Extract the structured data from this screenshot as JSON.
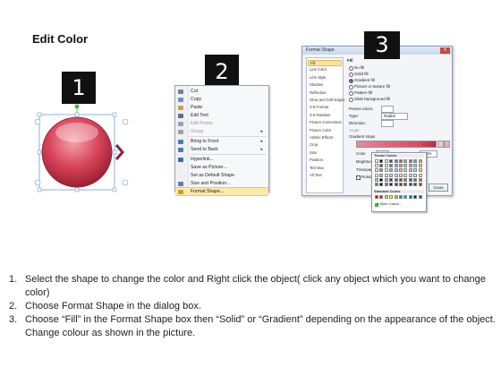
{
  "title": "Edit Color",
  "badges": [
    "1",
    "2",
    "3"
  ],
  "context_menu": {
    "items": [
      {
        "label": "Cut",
        "icon": "scissors-icon",
        "color": "#6f7fa0",
        "submenu": false
      },
      {
        "label": "Copy",
        "icon": "copy-icon",
        "color": "#7b8db3",
        "submenu": false
      },
      {
        "label": "Paste",
        "icon": "paste-icon",
        "color": "#c9a24a",
        "submenu": false
      },
      {
        "label": "Edit Text",
        "icon": "edit-text-icon",
        "color": "#5d6f8d",
        "submenu": false
      },
      {
        "label": "Edit Points",
        "icon": "edit-points-icon",
        "color": "#9aa2ad",
        "submenu": false
      },
      {
        "label": "Group",
        "icon": "group-icon",
        "color": "#9aa2ad",
        "submenu": true
      },
      {
        "label": "Bring to Front",
        "icon": "bring-front-icon",
        "color": "#4f78b8",
        "submenu": true
      },
      {
        "label": "Send to Back",
        "icon": "send-back-icon",
        "color": "#4f78b8",
        "submenu": true
      },
      {
        "label": "Hyperlink...",
        "icon": "hyperlink-icon",
        "color": "#3a6fb0",
        "submenu": false
      },
      {
        "label": "Save as Picture...",
        "icon": "",
        "color": "",
        "submenu": false
      },
      {
        "label": "Set as Default Shape",
        "icon": "",
        "color": "",
        "submenu": false
      },
      {
        "label": "Size and Position...",
        "icon": "size-position-icon",
        "color": "#5a7fb0",
        "submenu": false
      },
      {
        "label": "Format Shape...",
        "icon": "format-shape-icon",
        "color": "#d29a2e",
        "submenu": false
      }
    ]
  },
  "dialog": {
    "title": "Format Shape",
    "close_label": "X",
    "categories": [
      "Fill",
      "Line Color",
      "Line Style",
      "Shadow",
      "Reflection",
      "Glow and Soft Edges",
      "3-D Format",
      "3-D Rotation",
      "Picture Corrections",
      "Picture Color",
      "Artistic Effects",
      "Crop",
      "Size",
      "Position",
      "Text Box",
      "Alt Text"
    ],
    "selected_category": "Fill",
    "fill_heading": "Fill",
    "fill_options": [
      "No fill",
      "Solid fill",
      "Gradient fill",
      "Picture or texture fill",
      "Pattern fill",
      "Slide background fill"
    ],
    "selected_fill": "Gradient fill",
    "preset_colors_label": "Preset colors:",
    "type_label": "Type:",
    "type_value": "Radial",
    "direction_label": "Direction:",
    "angle_label": "Angle:",
    "gradient_stops_label": "Gradient stops",
    "color_label": "Color",
    "position_label": "Position:",
    "position_value": "100%",
    "brightness_label": "Brightness:",
    "transparency_label": "Transparency:",
    "rotate_label": "Rotate with shape",
    "close_button": "Close",
    "theme_colors_label": "Theme Colors",
    "standard_colors_label": "Standard Colors",
    "more_colors_label": "More Colors..."
  },
  "colors": {
    "circle_fill": "#d9455a",
    "arrow": "#8b2033",
    "gradient_bar": "#d94a5e",
    "selection_handle": "#6aa3c8",
    "rotate_handle": "#4caf50",
    "theme_colors": [
      "#ffffff",
      "#000000",
      "#eeece1",
      "#1f497d",
      "#4f81bd",
      "#c0504d",
      "#9bbb59",
      "#8064a2",
      "#4bacc6",
      "#f79646"
    ],
    "standard_colors": [
      "#c00000",
      "#ff0000",
      "#ffc000",
      "#ffff00",
      "#92d050",
      "#00b050",
      "#00b0f0",
      "#0070c0",
      "#002060",
      "#7030a0"
    ]
  },
  "instructions": [
    {
      "num": "1.",
      "text": "Select the shape to change the color and Right click the object( click any object which you want to change color)"
    },
    {
      "num": "2.",
      "text": "Choose Format Shape in the dialog box."
    },
    {
      "num": "3.",
      "text": "Choose “Fill” in the Format Shape box then “Solid” or “Gradient” depending on the appearance of the object. Change colour as shown in the picture."
    }
  ]
}
